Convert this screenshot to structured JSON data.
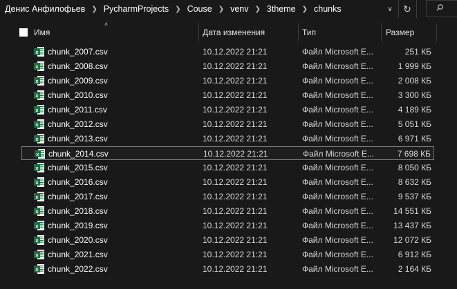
{
  "breadcrumb": [
    "Денис Анфилофьев",
    "PycharmProjects",
    "Couse",
    "venv",
    "3theme",
    "chunks"
  ],
  "columns": {
    "name": "Имя",
    "date": "Дата изменения",
    "type": "Тип",
    "size": "Размер"
  },
  "colors": {
    "background": "#191919",
    "excel_green": "#1d6f42",
    "selected_border": "#7a7a7a"
  },
  "files": [
    {
      "name": "chunk_2007.csv",
      "date": "10.12.2022 21:21",
      "type": "Файл Microsoft E...",
      "size": "251 КБ",
      "selected": false
    },
    {
      "name": "chunk_2008.csv",
      "date": "10.12.2022 21:21",
      "type": "Файл Microsoft E...",
      "size": "1 999 КБ",
      "selected": false
    },
    {
      "name": "chunk_2009.csv",
      "date": "10.12.2022 21:21",
      "type": "Файл Microsoft E...",
      "size": "2 008 КБ",
      "selected": false
    },
    {
      "name": "chunk_2010.csv",
      "date": "10.12.2022 21:21",
      "type": "Файл Microsoft E...",
      "size": "3 300 КБ",
      "selected": false
    },
    {
      "name": "chunk_2011.csv",
      "date": "10.12.2022 21:21",
      "type": "Файл Microsoft E...",
      "size": "4 189 КБ",
      "selected": false
    },
    {
      "name": "chunk_2012.csv",
      "date": "10.12.2022 21:21",
      "type": "Файл Microsoft E...",
      "size": "5 051 КБ",
      "selected": false
    },
    {
      "name": "chunk_2013.csv",
      "date": "10.12.2022 21:21",
      "type": "Файл Microsoft E...",
      "size": "6 971 КБ",
      "selected": false
    },
    {
      "name": "chunk_2014.csv",
      "date": "10.12.2022 21:21",
      "type": "Файл Microsoft E...",
      "size": "7 698 КБ",
      "selected": true
    },
    {
      "name": "chunk_2015.csv",
      "date": "10.12.2022 21:21",
      "type": "Файл Microsoft E...",
      "size": "8 050 КБ",
      "selected": false
    },
    {
      "name": "chunk_2016.csv",
      "date": "10.12.2022 21:21",
      "type": "Файл Microsoft E...",
      "size": "8 632 КБ",
      "selected": false
    },
    {
      "name": "chunk_2017.csv",
      "date": "10.12.2022 21:21",
      "type": "Файл Microsoft E...",
      "size": "9 537 КБ",
      "selected": false
    },
    {
      "name": "chunk_2018.csv",
      "date": "10.12.2022 21:21",
      "type": "Файл Microsoft E...",
      "size": "14 551 КБ",
      "selected": false
    },
    {
      "name": "chunk_2019.csv",
      "date": "10.12.2022 21:21",
      "type": "Файл Microsoft E...",
      "size": "13 437 КБ",
      "selected": false
    },
    {
      "name": "chunk_2020.csv",
      "date": "10.12.2022 21:21",
      "type": "Файл Microsoft E...",
      "size": "12 072 КБ",
      "selected": false
    },
    {
      "name": "chunk_2021.csv",
      "date": "10.12.2022 21:21",
      "type": "Файл Microsoft E...",
      "size": "6 912 КБ",
      "selected": false
    },
    {
      "name": "chunk_2022.csv",
      "date": "10.12.2022 21:21",
      "type": "Файл Microsoft E...",
      "size": "2 164 КБ",
      "selected": false
    }
  ],
  "icons": {
    "breadcrumb_separator": "chevron-right-icon",
    "dropdown": "chevron-down-icon",
    "refresh": "refresh-icon",
    "search": "search-icon",
    "file": "excel-file-icon"
  }
}
